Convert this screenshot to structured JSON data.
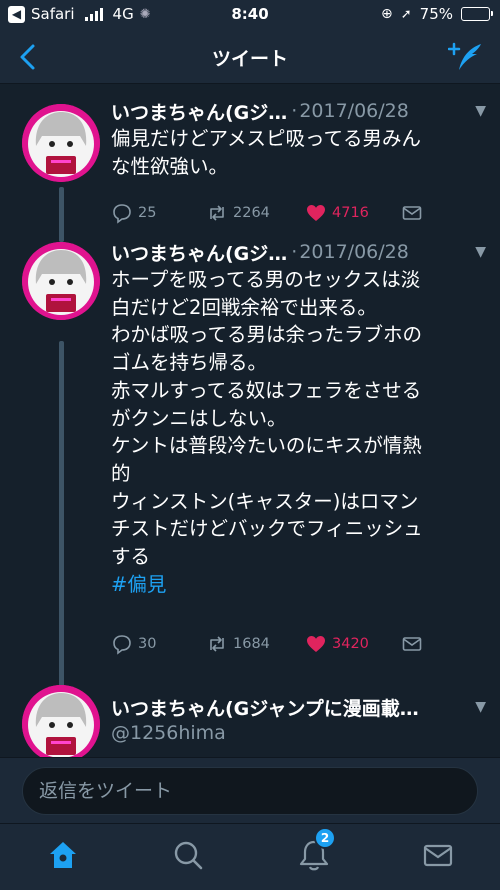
{
  "status_bar": {
    "carrier": "Safari",
    "network": "4G",
    "time": "8:40",
    "battery": "75%",
    "battery_level": 0.75
  },
  "nav": {
    "title": "ツイート",
    "back_icon": "chevron-left-icon",
    "compose_icon": "compose-tweet-icon"
  },
  "tweets": [
    {
      "name": "いつまちゃん(Gジ…",
      "date": "2017/06/28",
      "body_lines": [
        "偏見だけどアメスピ吸ってる男みん",
        "な性欲強い。"
      ],
      "replies": "25",
      "retweets": "2264",
      "likes": "4716",
      "liked": true
    },
    {
      "name": "いつまちゃん(Gジ…",
      "date": "2017/06/28",
      "body_lines": [
        "ホープを吸ってる男のセックスは淡",
        "白だけど2回戦余裕で出来る。",
        "わかば吸ってる男は余ったラブホの",
        "ゴムを持ち帰る。",
        "赤マルすってる奴はフェラをさせる",
        "がクンニはしない。",
        "ケントは普段冷たいのにキスが情熱",
        "的",
        "ウィンストン(キャスター)はロマン",
        "チストだけどバックでフィニッシュ",
        "する"
      ],
      "hashtag": "#偏見",
      "replies": "30",
      "retweets": "1684",
      "likes": "3420",
      "liked": true
    },
    {
      "name": "いつまちゃん(Gジャンプに漫画載…",
      "handle": "@1256hima"
    }
  ],
  "reply_bar": {
    "placeholder": "返信をツイート"
  },
  "tab_bar": {
    "items": [
      "home-icon",
      "search-icon",
      "notifications-icon",
      "messages-icon"
    ],
    "notifications_badge": "2"
  },
  "colors": {
    "background": "#15202b",
    "bar": "#1c2938",
    "accent": "#1da1f2",
    "like": "#e0245e",
    "muted": "#8899a6"
  }
}
